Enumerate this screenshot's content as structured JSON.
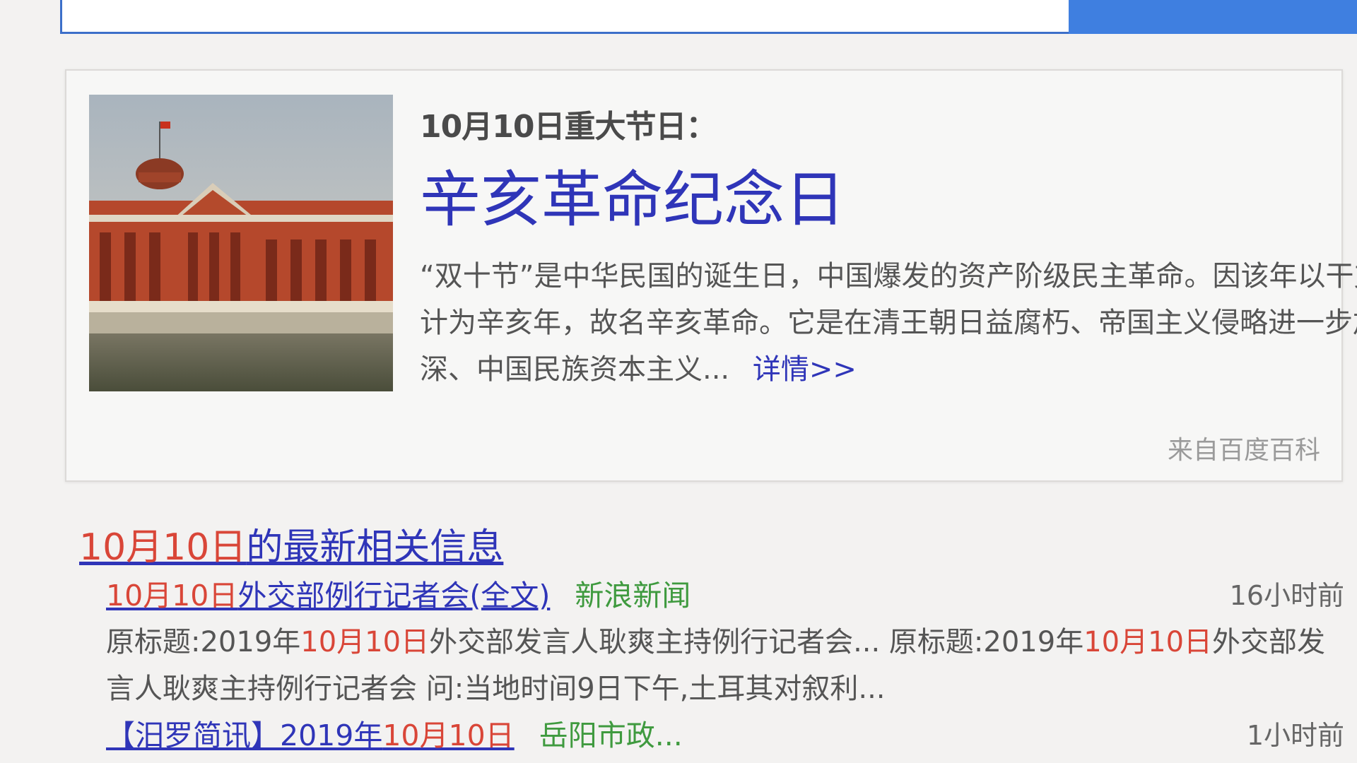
{
  "card": {
    "subtitle": "10月10日重大节日：",
    "title": "辛亥革命纪念日",
    "description": "“双十节”是中华民国的诞生日，中国爆发的资产阶级民主革命。因该年以干支计为辛亥年，故名辛亥革命。它是在清王朝日益腐朽、帝国主义侵略进一步加深、中国民族资本主义...",
    "more_link": "详情>>",
    "source": "来自百度百科"
  },
  "news": {
    "heading_date": "10月10日",
    "heading_rest": "的最新相关信息",
    "items": [
      {
        "title_date": "10月10日",
        "title_rest": "外交部例行记者会(全文)",
        "source": "新浪新闻",
        "time": "16小时前",
        "snippet_p1": "原标题:2019年",
        "snippet_date1": "10月10日",
        "snippet_p2": "外交部发言人耿爽主持例行记者会... 原标题:2019年",
        "snippet_date2": "10月10日",
        "snippet_p3": "外交部发言人耿爽主持例行记者会 问:当地时间9日下午,土耳其对叙利..."
      },
      {
        "title_prefix": "【汨罗简讯】2019年",
        "title_date": "10月10日",
        "source": "岳阳市政...",
        "time": "1小时前"
      }
    ]
  }
}
